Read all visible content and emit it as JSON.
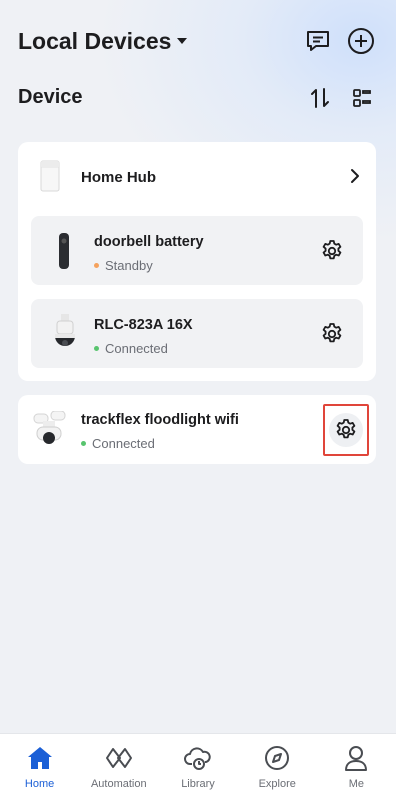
{
  "header": {
    "title": "Local Devices"
  },
  "section": {
    "title": "Device"
  },
  "hub": {
    "name": "Home Hub",
    "children": [
      {
        "name": "doorbell battery",
        "status": "Standby",
        "status_color": "#f5a25d"
      },
      {
        "name": "RLC-823A 16X",
        "status": "Connected",
        "status_color": "#58c46e"
      }
    ]
  },
  "standalone": {
    "name": "trackflex floodlight wifi",
    "status": "Connected",
    "status_color": "#58c46e"
  },
  "tabs": [
    {
      "label": "Home",
      "active": true
    },
    {
      "label": "Automation"
    },
    {
      "label": "Library"
    },
    {
      "label": "Explore"
    },
    {
      "label": "Me"
    }
  ],
  "colors": {
    "accent": "#1b5fd6",
    "highlight": "#e0453a"
  }
}
